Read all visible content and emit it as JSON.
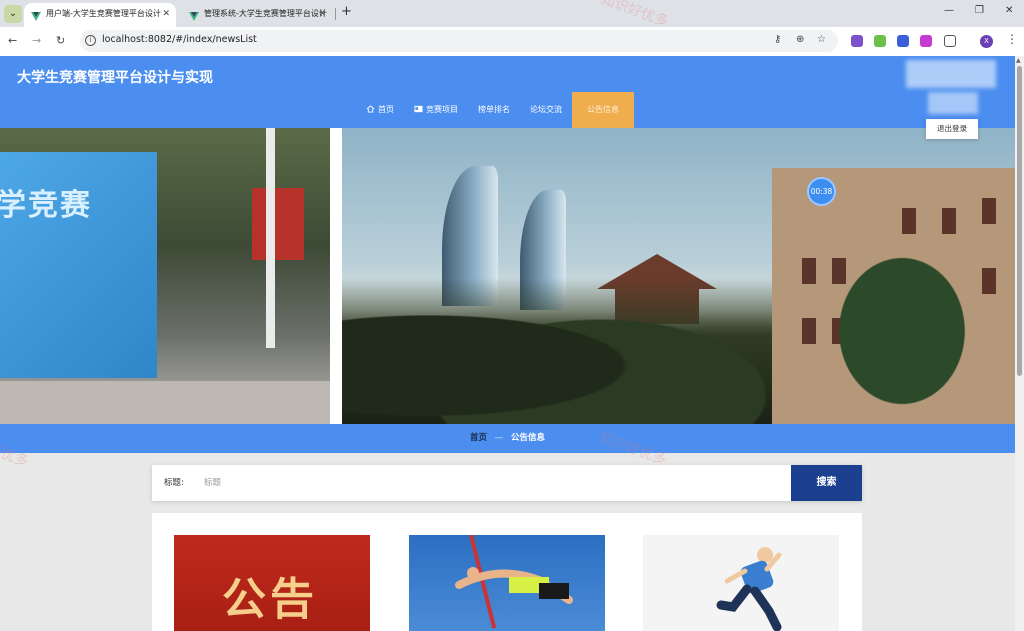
{
  "browser": {
    "tabs": [
      {
        "title": "用户端-大学生竞赛管理平台设计",
        "active": true
      },
      {
        "title": "管理系统-大学生竞赛管理平台设计",
        "active": false
      }
    ],
    "url": "localhost:8082/#/index/newsList",
    "new_tab_symbol": "+",
    "tab_close_symbol": "✕",
    "window_controls": {
      "minimize": "—",
      "restore": "❐",
      "close": "✕"
    },
    "profile_initial": "X",
    "icons": [
      "back-icon",
      "forward-icon",
      "reload-icon",
      "info-icon",
      "key-icon",
      "zoom-icon",
      "star-icon",
      "extension-icons",
      "puzzle-icon",
      "profile-icon",
      "kebab-icon"
    ]
  },
  "header": {
    "site_title": "大学生竞赛管理平台设计与实现",
    "logout_label": "退出登录",
    "nav": [
      {
        "label": "首页",
        "icon": "home-icon",
        "active": false
      },
      {
        "label": "竞赛项目",
        "icon": "id-card-icon",
        "active": false
      },
      {
        "label": "榜单排名",
        "icon": "",
        "active": false
      },
      {
        "label": "论坛交流",
        "icon": "",
        "active": false
      },
      {
        "label": "公告信息",
        "icon": "",
        "active": true
      }
    ],
    "accent_color": "#4b8ef0",
    "active_nav_color": "#f0ad4e"
  },
  "banner": {
    "left_board_text": "学竞赛",
    "timer": "00:38"
  },
  "breadcrumb": {
    "home": "首页",
    "separator": "—",
    "current": "公告信息"
  },
  "search": {
    "label": "标题:",
    "placeholder": "标题",
    "value": "",
    "button": "搜索",
    "button_color": "#1c3f8f"
  },
  "news": {
    "cards": [
      {
        "image": "notice-banner",
        "text": "公告"
      },
      {
        "image": "high-jump-photo"
      },
      {
        "image": "runner-illustration"
      }
    ]
  },
  "watermark_text": "知识好优多"
}
